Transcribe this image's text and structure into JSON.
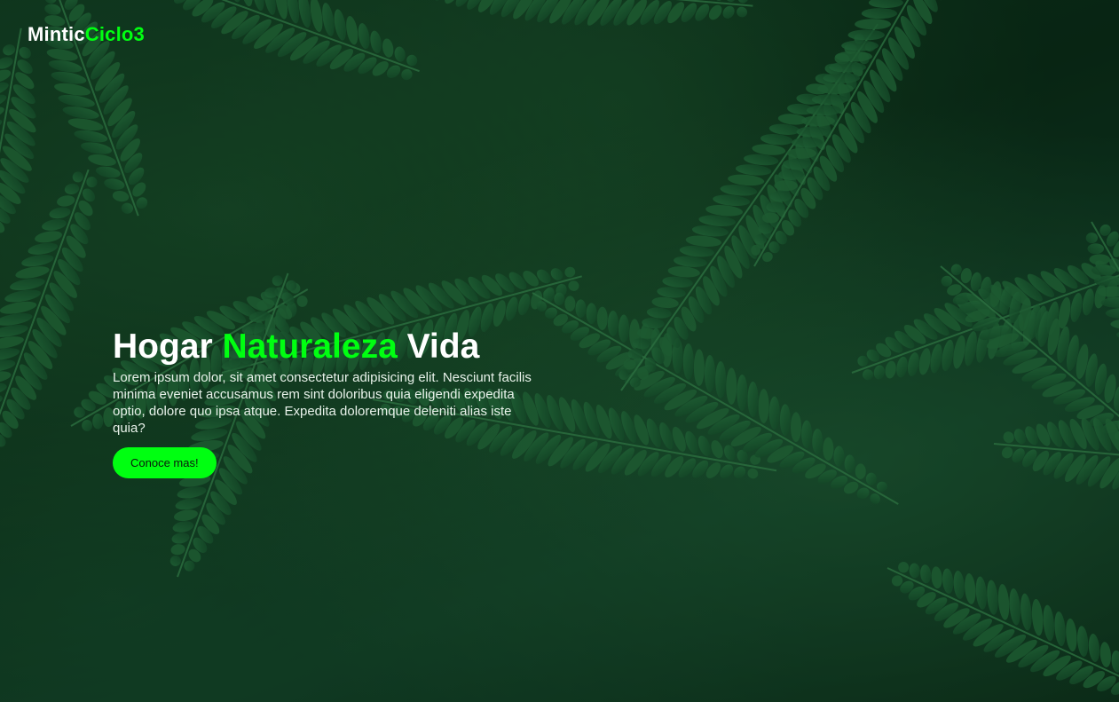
{
  "brand": {
    "name_part1": "Mintic",
    "name_part2": "Ciclo3"
  },
  "hero": {
    "title_part1": "Hogar ",
    "title_part2": "Naturaleza",
    "title_part3": " Vida",
    "description": "Lorem ipsum dolor, sit amet consectetur adipisicing elit. Nesciunt facilis minima eveniet accusamus rem sint doloribus quia eligendi expedita optio, dolore quo ipsa atque. Expedita doloremque deleniti alias iste quia?",
    "cta_label": "Conoce mas!"
  },
  "colors": {
    "accent": "#00ff11",
    "text": "#ffffff",
    "background": "#0b2a18"
  },
  "background_image": "fern-leaves-photo"
}
